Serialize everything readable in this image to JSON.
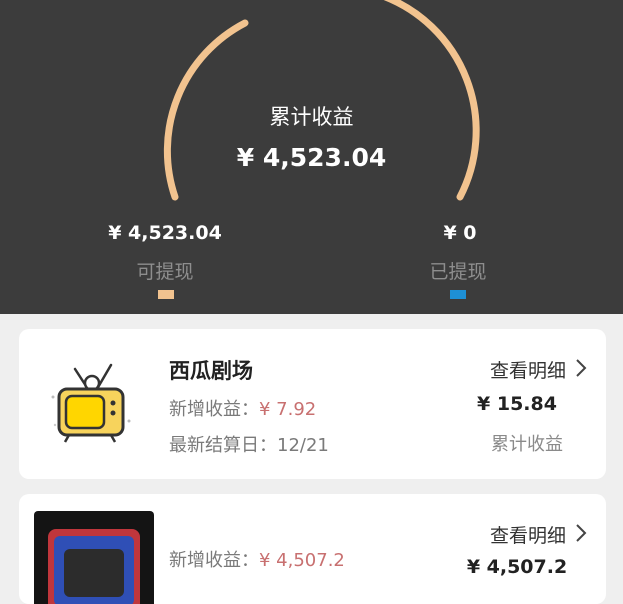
{
  "summary": {
    "title": "累计收益",
    "total": "¥ 4,523.04",
    "withdrawable_value": "¥ 4,523.04",
    "withdrawable_label": "可提现",
    "withdrawn_value": "¥ 0",
    "withdrawn_label": "已提现",
    "colors": {
      "withdrawable": "#f2c38f",
      "withdrawn": "#1e90d6",
      "background": "#3c3c3c"
    }
  },
  "items": [
    {
      "name": "西瓜剧场",
      "new_income_label": "新增收益：",
      "new_income_value": "¥ 7.92",
      "settle_label": "最新结算日：",
      "settle_date": "12/21",
      "detail_label": "查看明细",
      "total_value": "¥ 15.84",
      "total_label": "累计收益",
      "icon": "retro-tv-icon"
    },
    {
      "name": "",
      "new_income_label": "新增收益：",
      "new_income_value": "¥ 4,507.2",
      "detail_label": "查看明细",
      "total_value": "¥ 4,507.2",
      "icon": "tv-thumbnail"
    }
  ]
}
